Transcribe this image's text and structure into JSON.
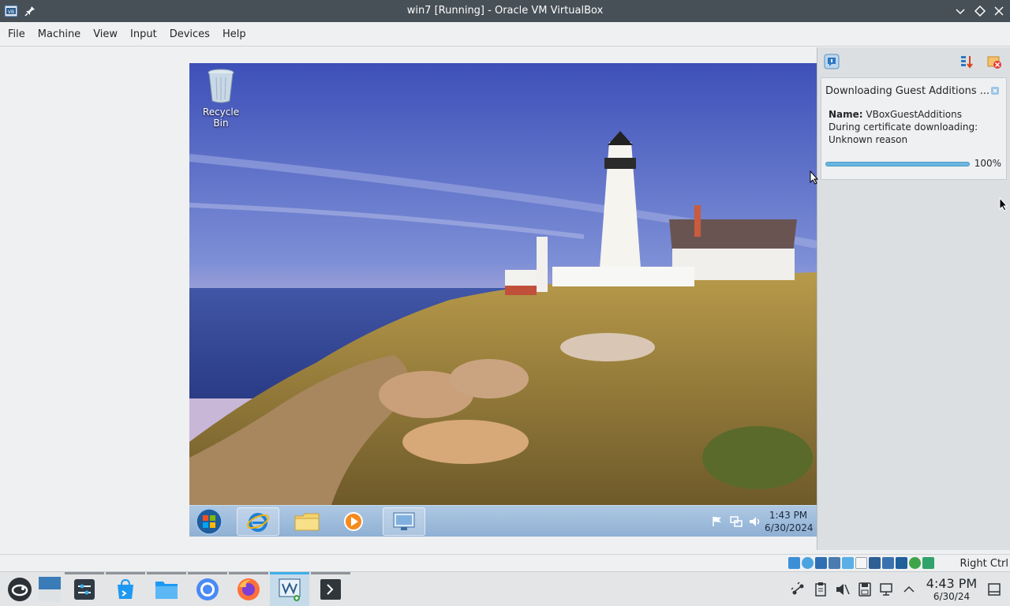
{
  "window": {
    "title": "win7 [Running] - Oracle VM VirtualBox"
  },
  "menubar": {
    "items": [
      "File",
      "Machine",
      "View",
      "Input",
      "Devices",
      "Help"
    ]
  },
  "guest": {
    "desktop_icons": [
      {
        "label": "Recycle Bin",
        "icon": "recycle-bin-icon"
      }
    ],
    "taskbar": {
      "pinned": [
        "internet-explorer-icon",
        "windows-explorer-icon",
        "media-player-icon",
        "remote-desktop-icon"
      ],
      "active_index": 0,
      "clock_time": "1:43 PM",
      "clock_date": "6/30/2024",
      "tray_icons": [
        "action-center-flag-icon",
        "network-icon",
        "volume-icon"
      ]
    }
  },
  "notification": {
    "title": "Downloading Guest Additions ...",
    "name_label": "Name:",
    "name_value": "VBoxGuestAdditions",
    "message": "During certificate downloading: Unknown reason",
    "progress": 100,
    "progress_text": "100%"
  },
  "statusbar": {
    "host_key": "Right Ctrl"
  },
  "host_taskbar": {
    "apps": [
      "opensuse-launcher-icon",
      "show-desktop-icon",
      "system-settings-icon",
      "discover-icon",
      "file-manager-icon",
      "chromium-icon",
      "firefox-icon",
      "virtualbox-icon",
      "terminal-icon"
    ],
    "clock_time": "4:43 PM",
    "clock_date": "6/30/24"
  },
  "colors": {
    "titlebar_bg": "#475057",
    "accent": "#3daee9",
    "progress_fill": "#6bb5de"
  }
}
